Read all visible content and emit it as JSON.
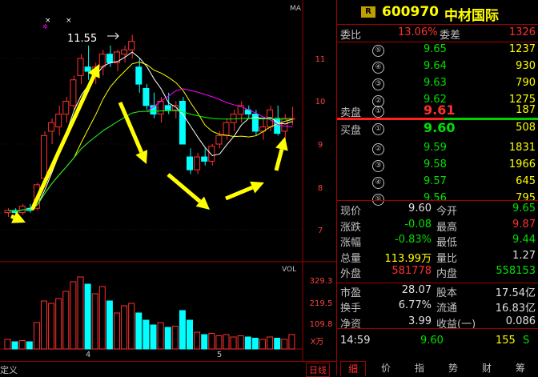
{
  "stock": {
    "code": "600970",
    "name": "中材国际",
    "badge": "R"
  },
  "chart": {
    "ma_label": "MA",
    "vol_label": "VOL",
    "high_annotation": "11.55",
    "price_ticks": [
      "11",
      "10",
      "9",
      "8",
      "7"
    ],
    "vol_ticks": [
      "329.3",
      "219.5",
      "109.8"
    ],
    "vol_unit": "X万",
    "x_ticks": [
      "4",
      "5"
    ],
    "bottom_left": "定义",
    "bottom_right": "日线"
  },
  "quote": {
    "weibi_label": "委比",
    "weibi": "13.06%",
    "weicha_label": "委差",
    "weicha": "1326",
    "sell_label": "卖盘",
    "buy_label": "买盘",
    "asks": [
      {
        "level": "⑤",
        "price": "9.65",
        "vol": "1237"
      },
      {
        "level": "④",
        "price": "9.64",
        "vol": "930"
      },
      {
        "level": "③",
        "price": "9.63",
        "vol": "790"
      },
      {
        "level": "②",
        "price": "9.62",
        "vol": "1275"
      },
      {
        "level": "①",
        "price": "9.61",
        "vol": "187"
      }
    ],
    "bids": [
      {
        "level": "①",
        "price": "9.60",
        "vol": "508"
      },
      {
        "level": "②",
        "price": "9.59",
        "vol": "1831"
      },
      {
        "level": "③",
        "price": "9.58",
        "vol": "1966"
      },
      {
        "level": "④",
        "price": "9.57",
        "vol": "645"
      },
      {
        "level": "⑤",
        "price": "9.56",
        "vol": "795"
      }
    ]
  },
  "stats": {
    "xianjia_l": "现价",
    "xianjia": "9.60",
    "jinkai_l": "今开",
    "jinkai": "9.65",
    "zhangdie_l": "涨跌",
    "zhangdie": "-0.08",
    "zuigao_l": "最高",
    "zuigao": "9.87",
    "zhangfu_l": "涨幅",
    "zhangfu": "-0.83%",
    "zuidi_l": "最低",
    "zuidi": "9.44",
    "zongliang_l": "总量",
    "zongliang": "113.99万",
    "liangbi_l": "量比",
    "liangbi": "1.27",
    "waipan_l": "外盘",
    "waipan": "581778",
    "neipan_l": "内盘",
    "neipan": "558153",
    "shiying_l": "市盈",
    "shiying": "28.07",
    "guben_l": "股本",
    "guben": "17.54亿",
    "huanshou_l": "换手",
    "huanshou": "6.77%",
    "liutong_l": "流通",
    "liutong": "16.83亿",
    "jingzi_l": "净资",
    "jingzi": "3.99",
    "shouyi_l": "收益(一)",
    "shouyi": "0.086"
  },
  "tick": {
    "time": "14:59",
    "price": "9.60",
    "vol": "155",
    "side": "S"
  },
  "tabs": [
    "细",
    "价",
    "指",
    "势",
    "财",
    "筹"
  ],
  "colors": {
    "up": "#ff3030",
    "down": "#00ffff",
    "ma5": "#ffffff",
    "ma10": "#ffff00",
    "ma20": "#ff00ff",
    "ma60": "#00ff00",
    "arrow": "#ffff00"
  }
}
